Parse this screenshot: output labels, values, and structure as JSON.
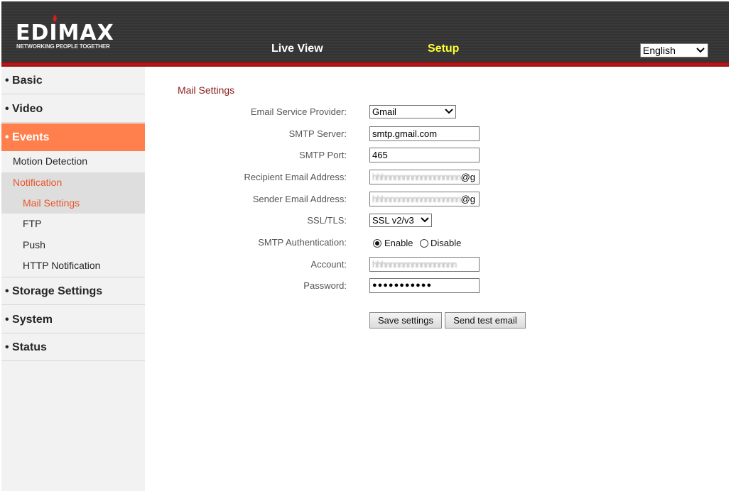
{
  "header": {
    "logo_text": "EDIMAX",
    "logo_tagline": "NETWORKING PEOPLE TOGETHER",
    "nav": {
      "live_view": "Live View",
      "setup": "Setup"
    },
    "language": "English"
  },
  "sidebar": {
    "basic": "• Basic",
    "video": "• Video",
    "events": "• Events",
    "motion_detection": "Motion Detection",
    "notification": "Notification",
    "mail_settings": "Mail Settings",
    "ftp": "FTP",
    "push": "Push",
    "http_notification": "HTTP Notification",
    "storage_settings": "• Storage Settings",
    "system": "• System",
    "status": "• Status"
  },
  "main": {
    "title": "Mail Settings",
    "labels": {
      "provider": "Email Service Provider:",
      "smtp_server": "SMTP Server:",
      "smtp_port": "SMTP Port:",
      "recipient": "Recipient Email Address:",
      "sender": "Sender Email Address:",
      "ssl": "SSL/TLS:",
      "auth": "SMTP Authentication:",
      "account": "Account:",
      "password": "Password:"
    },
    "values": {
      "provider": "Gmail",
      "smtp_server": "smtp.gmail.com",
      "smtp_port": "465",
      "recipient_blur": "hhhnnnnnnnnnnnnnnnnn",
      "recipient_suffix": "@g",
      "sender_blur": "hhhnnnnnnnnnnnnnnnnn",
      "sender_suffix": "@g",
      "ssl": "SSL v2/v3",
      "account_blur": "hhhnnnnnnnnnnnnnnnn",
      "password": "●●●●●●●●●●●"
    },
    "auth_options": {
      "enable": "Enable",
      "disable": "Disable"
    },
    "buttons": {
      "save": "Save settings",
      "test": "Send test email"
    }
  },
  "colors": {
    "accent_orange": "#ff7f4d",
    "title_red": "#8b1a1a",
    "setup_yellow": "#ffff33",
    "highlight_text": "#e8562a"
  }
}
